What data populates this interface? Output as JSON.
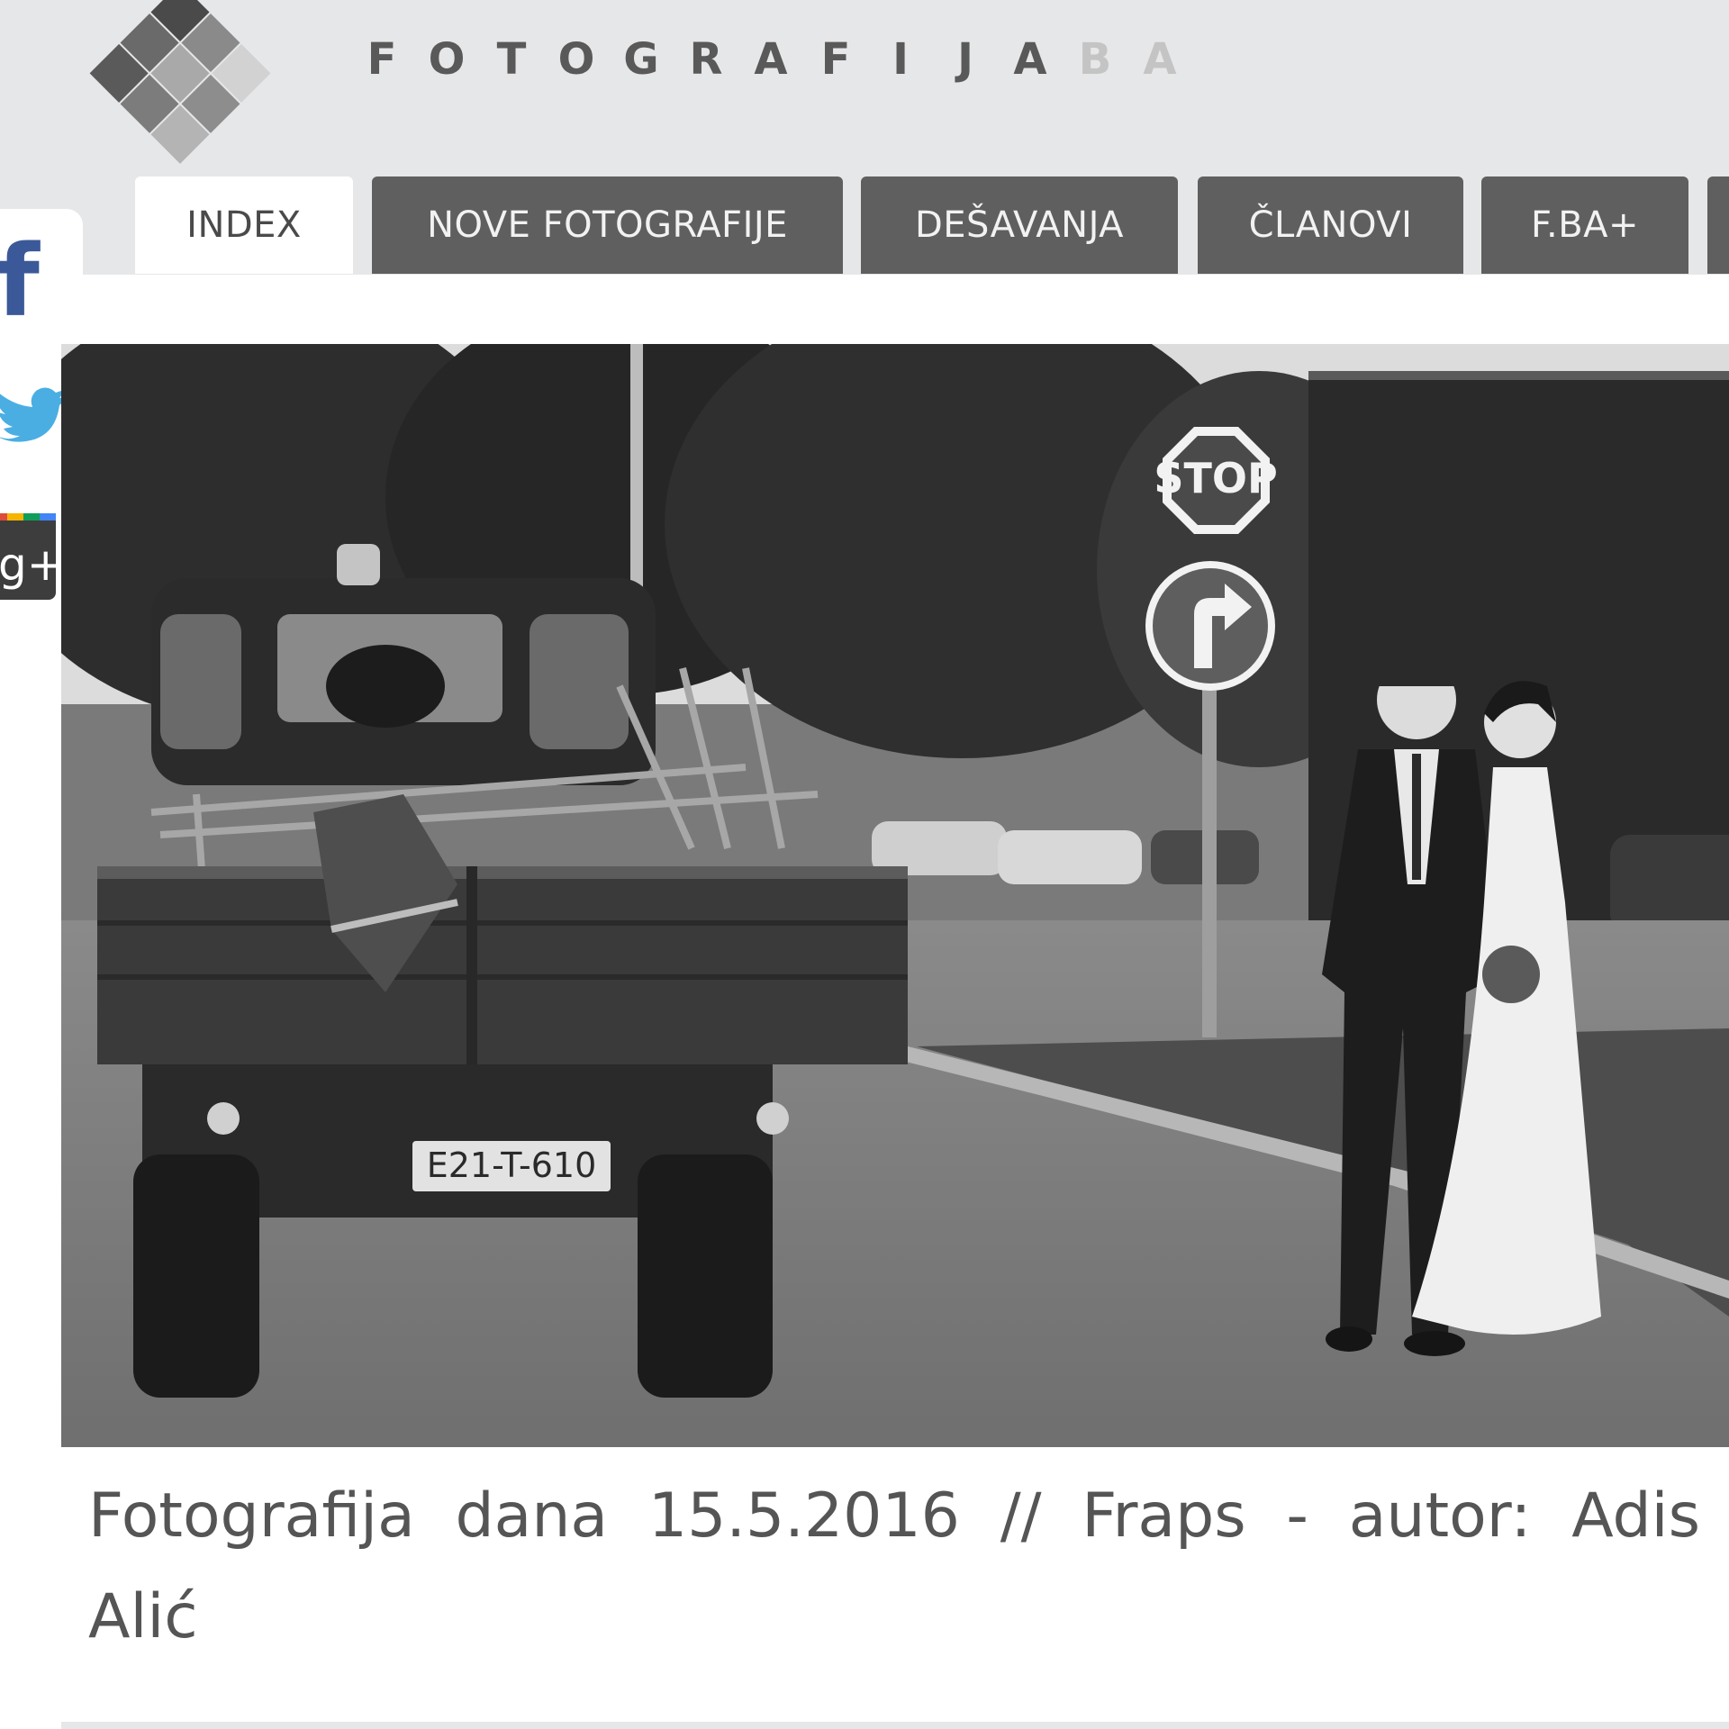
{
  "site": {
    "logo_letters": [
      "F",
      "O",
      "T",
      "O",
      "G",
      "R",
      "A",
      "F",
      "I",
      "J",
      "A",
      "B",
      "A"
    ],
    "logo_muted_from": 11
  },
  "nav": {
    "tabs": [
      {
        "label": "INDEX",
        "active": true
      },
      {
        "label": "NOVE FOTOGRAFIJE",
        "active": false
      },
      {
        "label": "DEŠAVANJA",
        "active": false
      },
      {
        "label": "ČLANOVI",
        "active": false
      },
      {
        "label": "F.BA+",
        "active": false
      }
    ]
  },
  "social": [
    {
      "icon": "facebook-icon",
      "glyph": "f",
      "color": "#3b5998"
    },
    {
      "icon": "twitter-icon",
      "color": "#4aaee3"
    },
    {
      "icon": "google-plus-icon",
      "glyph": "g+",
      "color": "#3d3d3d"
    }
  ],
  "photo": {
    "stop_sign": "STOP",
    "plate": "E21-T-610"
  },
  "caption": "Fotografija dana 15.5.2016 // Fraps - autor: Adis Alić",
  "colors": {
    "header_bg": "#e6e7e9",
    "tab_bg": "#5f5f5f",
    "tab_text": "#f2f2f2",
    "caption_text": "#555555"
  }
}
